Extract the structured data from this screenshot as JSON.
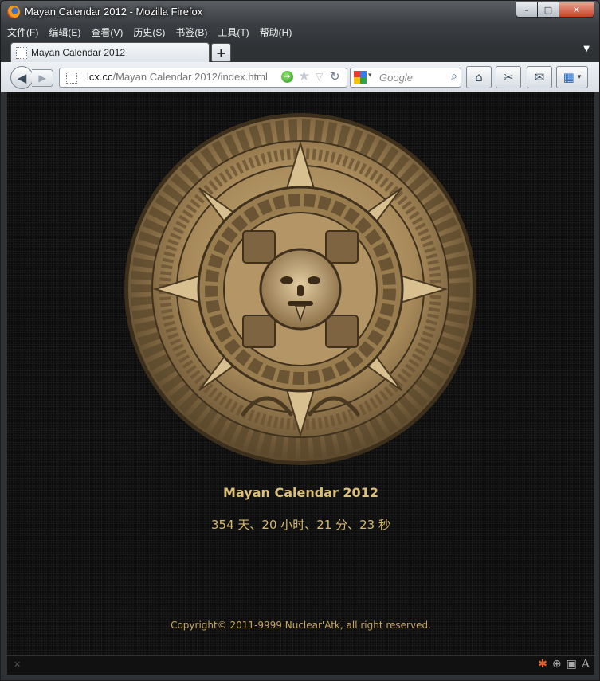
{
  "window": {
    "title": "Mayan Calendar 2012 - Mozilla Firefox",
    "min_label": "–",
    "max_label": "□",
    "close_label": "✕"
  },
  "menubar": {
    "items": [
      "文件(F)",
      "编辑(E)",
      "查看(V)",
      "历史(S)",
      "书签(B)",
      "工具(T)",
      "帮助(H)"
    ]
  },
  "tabs": {
    "active_label": "Mayan Calendar 2012",
    "new_tab_label": "+",
    "list_label": "▼"
  },
  "navbar": {
    "url_domain": "lcx.cc",
    "url_path": "/Mayan Calendar 2012/index.html",
    "search_placeholder": "Google",
    "back_icon": "back-arrow-icon",
    "forward_icon": "forward-arrow-icon"
  },
  "page": {
    "title": "Mayan Calendar 2012",
    "countdown": "354 天、20 小时、21 分、23 秒",
    "copyright": "Copyright© 2011-9999 Nuclear'Atk, all right reserved."
  },
  "colors": {
    "page_bg": "#0c0c0c",
    "gold_text": "#dcc07a",
    "stone": "#a88a5a"
  }
}
